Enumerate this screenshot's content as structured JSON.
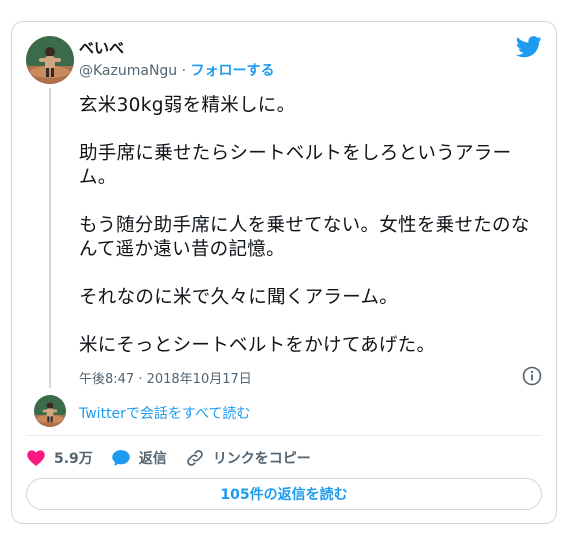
{
  "author": {
    "display_name": "べいべ",
    "handle": "@KazumaNgu",
    "separator": " · ",
    "follow_label": "フォローする"
  },
  "tweet": {
    "paragraphs": [
      "玄米30kg弱を精米しに。",
      "助手席に乗せたらシートベルトをしろというアラーム。",
      "もう随分助手席に人を乗せてない。女性を乗せたのなんて遥か遠い昔の記憶。",
      "それなのに米で久々に聞くアラーム。",
      "米にそっとシートベルトをかけてあげた。"
    ],
    "timestamp": "午後8:47 · 2018年10月17日"
  },
  "conversation": {
    "read_all_label": "Twitterで会話をすべて読む"
  },
  "actions": {
    "like_count": "5.9万",
    "reply_label": "返信",
    "copy_link_label": "リンクをコピー"
  },
  "replies_button": {
    "label": "105件の返信を読む"
  },
  "colors": {
    "accent": "#1d9bf0",
    "like": "#f91880",
    "text_secondary": "#536471",
    "border": "#cfd9de"
  },
  "icons": {
    "logo": "twitter-bird-icon",
    "info": "info-icon",
    "like": "heart-icon",
    "reply": "speech-bubble-icon",
    "copy": "link-icon"
  }
}
